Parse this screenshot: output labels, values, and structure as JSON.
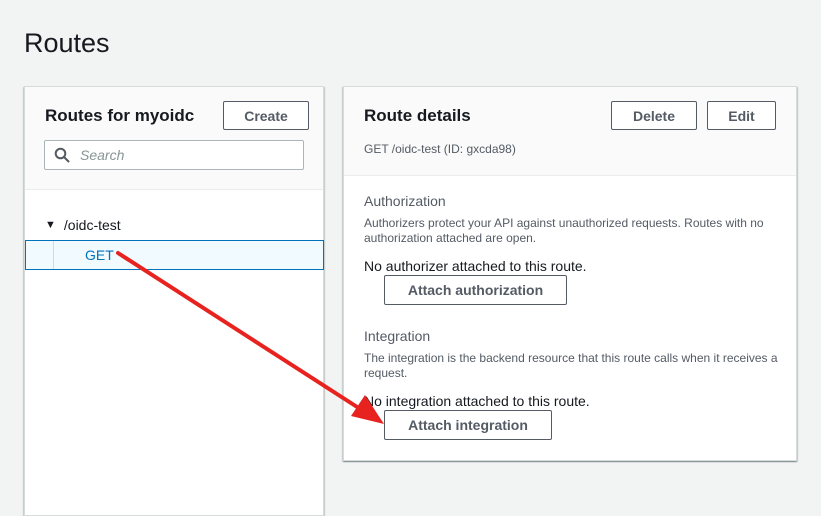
{
  "page": {
    "title": "Routes"
  },
  "routes_panel": {
    "title": "Routes for myoidc",
    "create_label": "Create",
    "search_placeholder": "Search",
    "tree": {
      "parent_label": "/oidc-test",
      "child_label": "GET"
    }
  },
  "details_panel": {
    "title": "Route details",
    "subtitle": "GET /oidc-test (ID: gxcda98)",
    "delete_label": "Delete",
    "edit_label": "Edit",
    "authorization": {
      "heading": "Authorization",
      "description": "Authorizers protect your API against unauthorized requests. Routes with no authorization attached are open.",
      "status": "No authorizer attached to this route.",
      "button_label": "Attach authorization"
    },
    "integration": {
      "heading": "Integration",
      "description": "The integration is the backend resource that this route calls when it receives a request.",
      "status": "No integration attached to this route.",
      "button_label": "Attach integration"
    }
  },
  "annotation": {
    "arrow_color": "#e8231f"
  },
  "colors": {
    "accent": "#0073bb",
    "background": "#f2f3f3",
    "selected_row_bg": "#f1faff"
  }
}
